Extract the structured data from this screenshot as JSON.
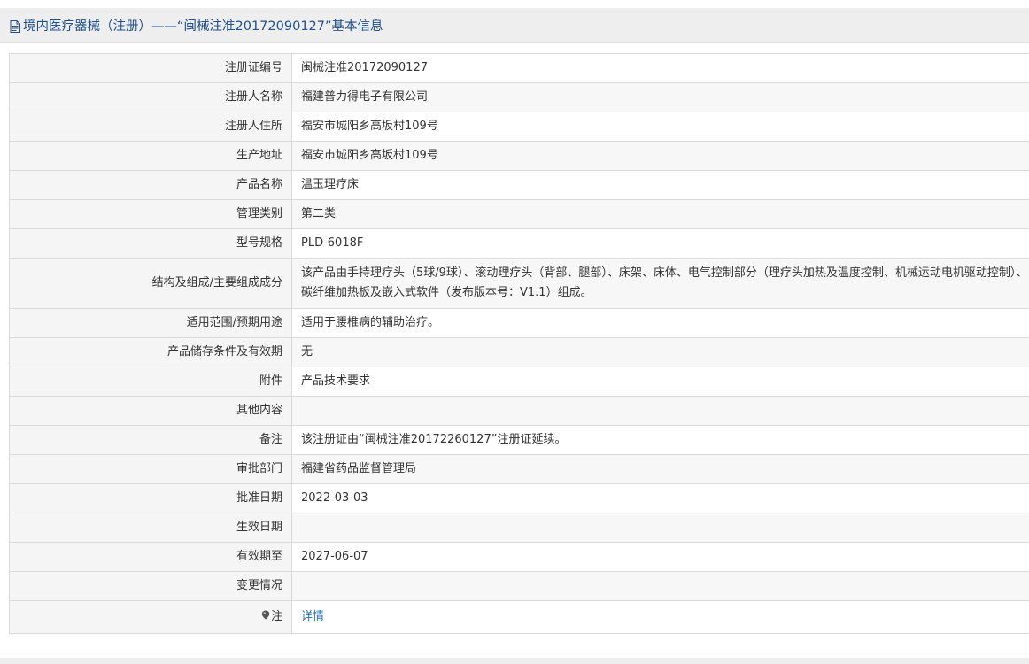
{
  "header": {
    "icon": "document-icon",
    "title": "境内医疗器械（注册）——“闽械注准20172090127”基本信息"
  },
  "rows": [
    {
      "label": "注册证编号",
      "value": "闽械注准20172090127"
    },
    {
      "label": "注册人名称",
      "value": "福建普力得电子有限公司"
    },
    {
      "label": "注册人住所",
      "value": "福安市城阳乡高坂村109号"
    },
    {
      "label": "生产地址",
      "value": "福安市城阳乡高坂村109号"
    },
    {
      "label": "产品名称",
      "value": "温玉理疗床"
    },
    {
      "label": "管理类别",
      "value": "第二类"
    },
    {
      "label": "型号规格",
      "value": "PLD-6018F"
    },
    {
      "label": "结构及组成/主要组成成分",
      "value": "该产品由手持理疗头（5球/9球）、滚动理疗头（背部、腿部）、床架、床体、电气控制部分（理疗头加热及温度控制、机械运动电机驱动控制）、碳纤维加热板及嵌入式软件（发布版本号：V1.1）组成。"
    },
    {
      "label": "适用范围/预期用途",
      "value": "适用于腰椎病的辅助治疗。"
    },
    {
      "label": "产品储存条件及有效期",
      "value": "无"
    },
    {
      "label": "附件",
      "value": "产品技术要求"
    },
    {
      "label": "其他内容",
      "value": ""
    },
    {
      "label": "备注",
      "value": "该注册证由“闽械注准20172260127”注册证延续。"
    },
    {
      "label": "审批部门",
      "value": "福建省药品监督管理局"
    },
    {
      "label": "批准日期",
      "value": "2022-03-03"
    },
    {
      "label": "生效日期",
      "value": ""
    },
    {
      "label": "有效期至",
      "value": "2027-06-07"
    },
    {
      "label": "变更情况",
      "value": ""
    }
  ],
  "note_row": {
    "icon": "pin-icon",
    "label": "注",
    "link_text": "详情"
  },
  "colors": {
    "title": "#1f4f8c",
    "link": "#2a6fb5",
    "border": "#d9d9d9",
    "header_bg": "#eeeeee"
  }
}
